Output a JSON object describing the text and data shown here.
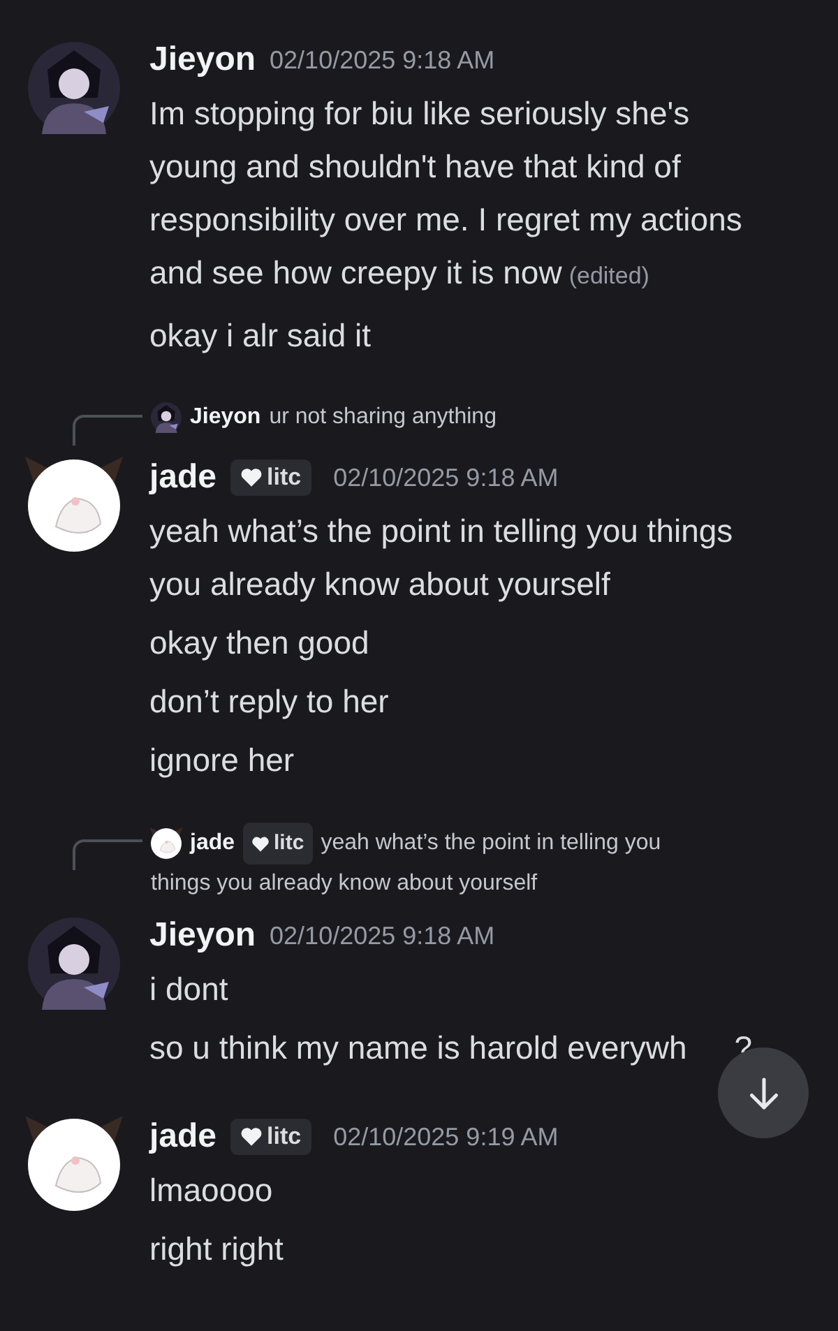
{
  "messages": [
    {
      "author": "Jieyon",
      "time": "02/10/2025 9:18 AM",
      "lines": [
        {
          "text": "Im stopping for biu like seriously she's young and shouldn't have that kind of responsibility over me. I regret my actions and see how creepy it is now",
          "edited": "(edited)"
        },
        {
          "text": "okay i alr said it"
        }
      ]
    },
    {
      "author": "jade",
      "tag": "litc",
      "time": "02/10/2025 9:18 AM",
      "reply": {
        "author": "Jieyon",
        "text": "ur not sharing anything"
      },
      "lines": [
        {
          "text": "yeah what’s the point in telling you things you already know about yourself"
        },
        {
          "text": "okay then good"
        },
        {
          "text": "don’t reply to her"
        },
        {
          "text": "ignore her"
        }
      ]
    },
    {
      "author": "Jieyon",
      "time": "02/10/2025 9:18 AM",
      "reply": {
        "author": "jade",
        "tag": "litc",
        "text": "yeah what’s the point in telling you things you already know about yourself"
      },
      "lines": [
        {
          "text": "i dont"
        },
        {
          "text": "so u think my name is harold everywh",
          "tail": "?"
        }
      ]
    },
    {
      "author": "jade",
      "tag": "litc",
      "time": "02/10/2025 9:19 AM",
      "lines": [
        {
          "text": "lmaoooo"
        },
        {
          "text": "right right"
        }
      ]
    }
  ]
}
